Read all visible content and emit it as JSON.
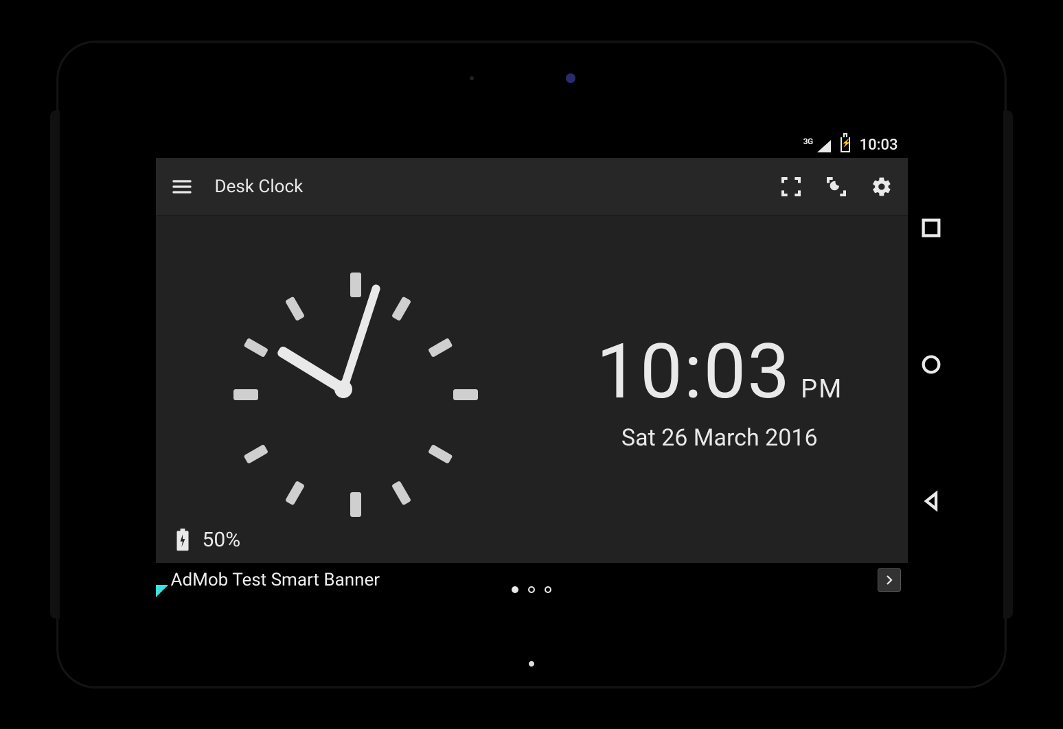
{
  "statusbar": {
    "network": "3G",
    "time": "10:03"
  },
  "appbar": {
    "title": "Desk Clock",
    "icons": {
      "menu": "menu-icon",
      "fullscreen": "fullscreen-icon",
      "night": "night-fullscreen-icon",
      "settings": "gear-icon"
    }
  },
  "clock": {
    "digital_time": "10:03",
    "ampm": "PM",
    "date": "Sat 26 March 2016",
    "hour_angle": 301.5,
    "minute_angle": 18
  },
  "battery": {
    "percent_text": "50%"
  },
  "ad": {
    "text": "AdMob Test Smart Banner",
    "page_active": 0,
    "pages": 3
  },
  "colors": {
    "bg": "#222",
    "bar": "#272727",
    "fg": "#e9e9e9"
  }
}
